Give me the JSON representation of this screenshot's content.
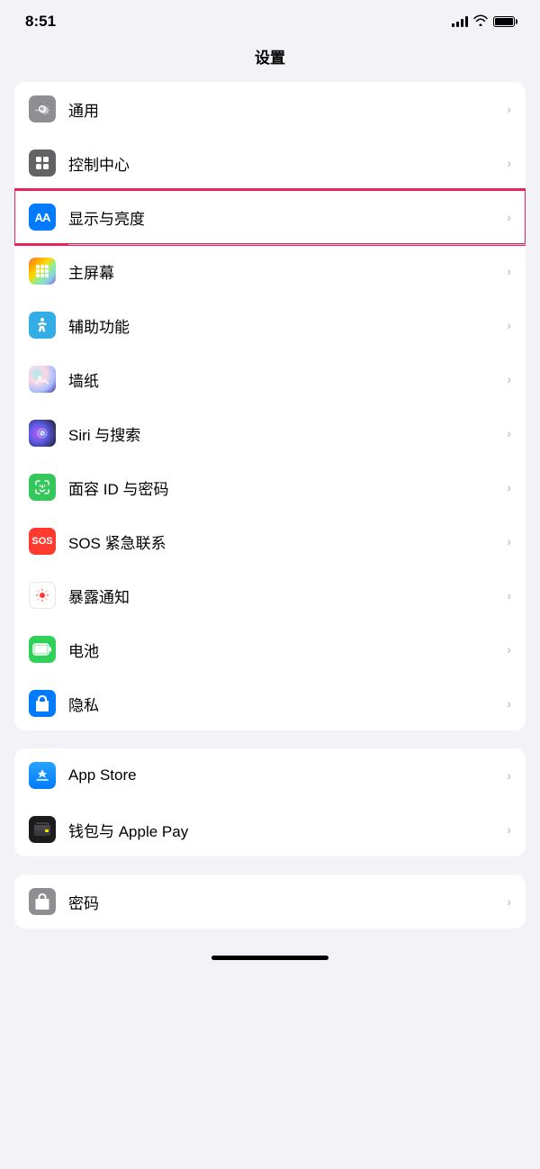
{
  "statusBar": {
    "time": "8:51",
    "signal": "full",
    "wifi": true,
    "battery": "full"
  },
  "pageTitle": "设置",
  "groups": [
    {
      "id": "general",
      "rows": [
        {
          "id": "general",
          "label": "通用",
          "iconBg": "gray",
          "iconType": "gear"
        },
        {
          "id": "control-center",
          "label": "控制中心",
          "iconBg": "gray2",
          "iconType": "toggles"
        },
        {
          "id": "display",
          "label": "显示与亮度",
          "iconBg": "blue",
          "iconType": "aa",
          "highlighted": true
        },
        {
          "id": "home-screen",
          "label": "主屏幕",
          "iconBg": "colorful",
          "iconType": "dots"
        },
        {
          "id": "accessibility",
          "label": "辅助功能",
          "iconBg": "cyan",
          "iconType": "accessibility"
        },
        {
          "id": "wallpaper",
          "label": "墙纸",
          "iconBg": "wallpaper",
          "iconType": "wallpaper"
        },
        {
          "id": "siri",
          "label": "Siri 与搜索",
          "iconBg": "siri",
          "iconType": "siri"
        },
        {
          "id": "faceid",
          "label": "面容 ID 与密码",
          "iconBg": "green",
          "iconType": "faceid"
        },
        {
          "id": "sos",
          "label": "SOS 紧急联系",
          "iconBg": "red",
          "iconType": "sos"
        },
        {
          "id": "exposure",
          "label": "暴露通知",
          "iconBg": "white",
          "iconType": "exposure"
        },
        {
          "id": "battery",
          "label": "电池",
          "iconBg": "green2",
          "iconType": "battery"
        },
        {
          "id": "privacy",
          "label": "隐私",
          "iconBg": "blue2",
          "iconType": "privacy"
        }
      ]
    },
    {
      "id": "apps",
      "rows": [
        {
          "id": "appstore",
          "label": "App Store",
          "iconBg": "appstore",
          "iconType": "appstore"
        },
        {
          "id": "wallet",
          "label": "钱包与 Apple Pay",
          "iconBg": "wallet",
          "iconType": "wallet"
        }
      ]
    },
    {
      "id": "passwords",
      "rows": [
        {
          "id": "passwords",
          "label": "密码",
          "iconBg": "password",
          "iconType": "password"
        }
      ]
    }
  ],
  "chevron": "›"
}
